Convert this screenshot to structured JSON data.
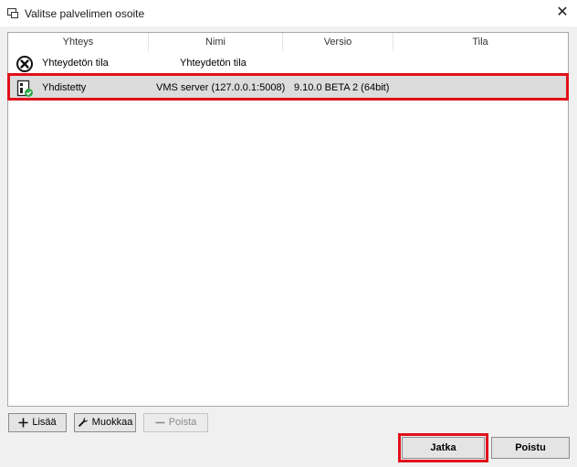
{
  "window": {
    "title": "Valitse palvelimen osoite",
    "close_glyph": "✕"
  },
  "list": {
    "columns": [
      "Yhteys",
      "Nimi",
      "Versio",
      "Tila"
    ],
    "rows": [
      {
        "icon": "disconnected-x-icon",
        "connection": "Yhteydetön tila",
        "name": "Yhteydetön tila",
        "version": "",
        "status": ""
      },
      {
        "icon": "server-connected-icon",
        "connection": "Yhdistetty",
        "name": "VMS server (127.0.0.1:5008)",
        "version": "9.10.0 BETA 2 (64bit)",
        "status": ""
      }
    ]
  },
  "buttons": {
    "add": "Lisää",
    "edit": "Muokkaa",
    "remove": "Poista",
    "continue": "Jatka",
    "exit": "Poistu"
  },
  "colors": {
    "highlight": "#e0101a",
    "connected_check": "#2ea84a"
  }
}
